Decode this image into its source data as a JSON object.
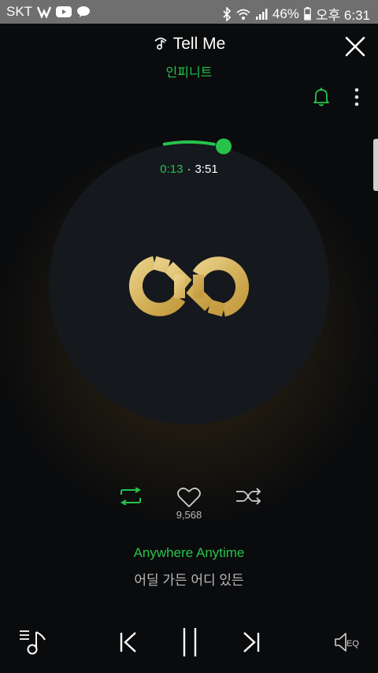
{
  "status_bar": {
    "carrier": "SKT",
    "battery": "46%",
    "time": "오후 6:31"
  },
  "song": {
    "title": "Tell Me",
    "artist": "인피니트",
    "current_time": "0:13",
    "separator": "·",
    "total_time": "3:51",
    "progress": 0.056,
    "likes": "9,568"
  },
  "lyrics": {
    "current": "Anywhere Anytime",
    "next": "어딜 가든 어디 있든"
  },
  "bottom_bar": {
    "eq_label": "EQ"
  },
  "colors": {
    "accent": "#27c24c",
    "background": "#0a0b0d",
    "disc": "#15181d",
    "gold": "#d9b865",
    "statusbar": "#6f6f6f"
  },
  "icons": [
    "music-note-icon",
    "close-icon",
    "bell-icon",
    "more-vertical-icon",
    "repeat-icon",
    "heart-icon",
    "shuffle-icon",
    "playlist-icon",
    "previous-icon",
    "pause-icon",
    "next-icon",
    "eq-icon"
  ]
}
